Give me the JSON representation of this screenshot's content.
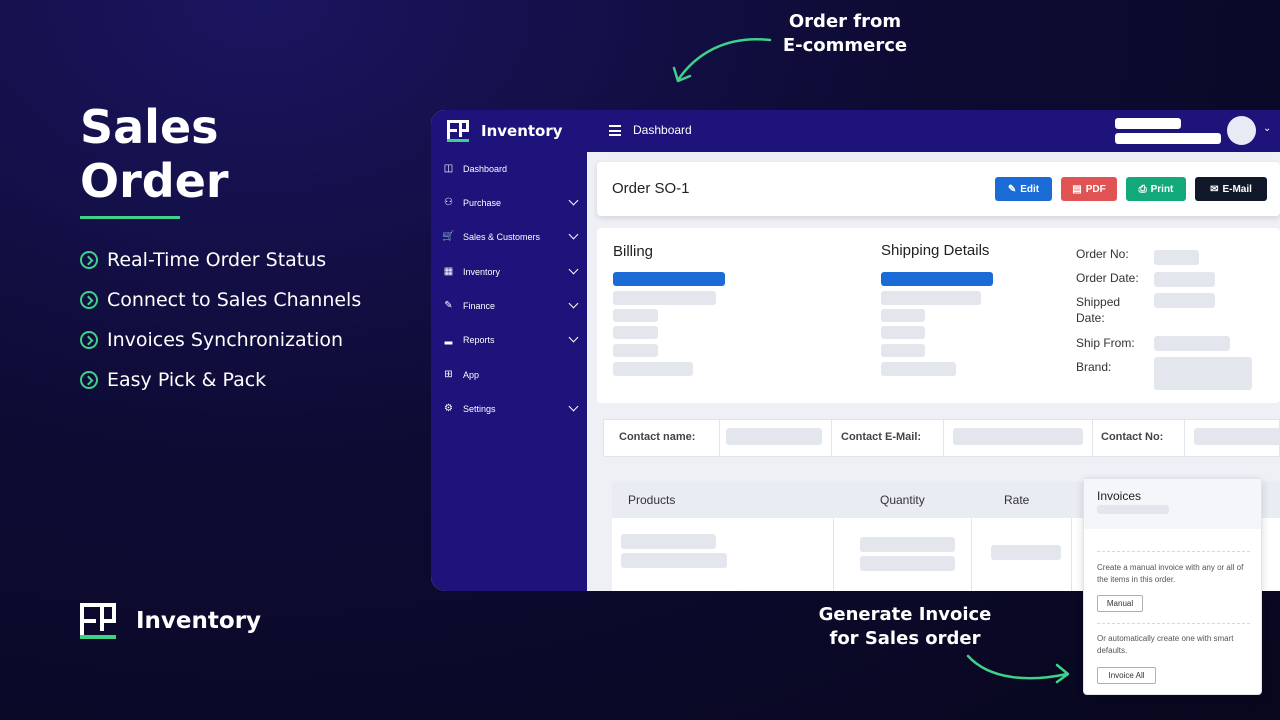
{
  "hero": {
    "title_line1": "Sales",
    "title_line2": "Order",
    "features": [
      "Real-Time Order Status",
      "Connect to Sales Channels",
      "Invoices Synchronization",
      "Easy Pick & Pack"
    ]
  },
  "brand": {
    "name": "Inventory"
  },
  "annotations": {
    "top_line1": "Order from",
    "top_line2": "E-commerce",
    "bottom_line1": "Generate Invoice",
    "bottom_line2": "for Sales order"
  },
  "app": {
    "name": "Inventory",
    "topbar_title": "Dashboard",
    "sidebar": [
      {
        "label": "Dashboard",
        "icon": "dashboard-icon"
      },
      {
        "label": "Purchase",
        "icon": "users-icon"
      },
      {
        "label": "Sales & Customers",
        "icon": "cart-icon"
      },
      {
        "label": "Inventory",
        "icon": "boxes-icon"
      },
      {
        "label": "Finance",
        "icon": "finance-icon"
      },
      {
        "label": "Reports",
        "icon": "bar-chart-icon"
      },
      {
        "label": "App",
        "icon": "grid-icon"
      },
      {
        "label": "Settings",
        "icon": "gear-icon"
      }
    ],
    "order_title": "Order SO-1",
    "buttons": {
      "edit": "Edit",
      "pdf": "PDF",
      "print": "Print",
      "email": "E-Mail"
    },
    "billing_title": "Billing",
    "shipping_title": "Shipping Details",
    "meta": {
      "order_no": "Order No:",
      "order_date": "Order Date:",
      "shipped_date_1": "Shipped",
      "shipped_date_2": "Date:",
      "ship_from": "Ship From:",
      "brand": "Brand:"
    },
    "contact": {
      "name": "Contact name:",
      "email": "Contact E-Mail:",
      "no": "Contact No:"
    },
    "products": {
      "col_products": "Products",
      "col_quantity": "Quantity",
      "col_rate": "Rate"
    },
    "invoices": {
      "title": "Invoices",
      "manual_text": "Create a manual invoice with any or all of the items in this order.",
      "manual_button": "Manual",
      "auto_text": "Or automatically create one with smart defaults.",
      "auto_button": "Invoice All"
    }
  },
  "colors": {
    "accent_green": "#3fd08a",
    "app_navy": "#1d137a",
    "edit_blue": "#1a6bd6",
    "pdf_red": "#e05353",
    "print_green": "#13a97a",
    "email_dark": "#111827"
  }
}
